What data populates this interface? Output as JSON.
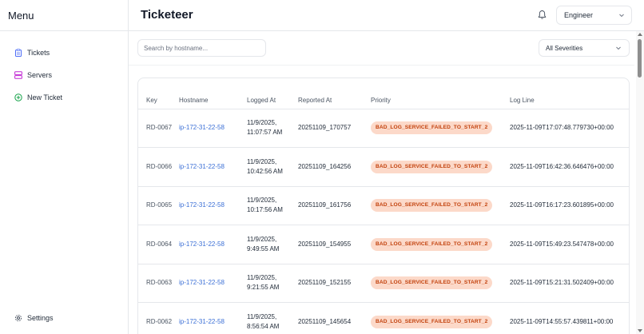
{
  "sidebar": {
    "title": "Menu",
    "items": [
      {
        "label": "Tickets",
        "icon": "clipboard-icon",
        "color": "#4f6ef7"
      },
      {
        "label": "Servers",
        "icon": "server-icon",
        "color": "#c026d3"
      },
      {
        "label": "New Ticket",
        "icon": "plus-circle-icon",
        "color": "#16a34a"
      }
    ],
    "settings": {
      "label": "Settings",
      "icon": "gear-icon"
    }
  },
  "header": {
    "title": "Ticketeer",
    "role": "Engineer"
  },
  "filters": {
    "search_placeholder": "Search by hostname...",
    "severity": "All Severities"
  },
  "table": {
    "columns": [
      "Key",
      "Hostname",
      "Logged At",
      "Reported At",
      "Priority",
      "Log Line"
    ],
    "rows": [
      {
        "key": "RD-0067",
        "hostname": "ip-172-31-22-58",
        "logged_at": "11/9/2025, 11:07:57 AM",
        "reported_at": "20251109_170757",
        "priority": "BAD_LOG_SERVICE_FAILED_TO_START_2",
        "log_line": "2025-11-09T17:07:48.779730+00:00"
      },
      {
        "key": "RD-0066",
        "hostname": "ip-172-31-22-58",
        "logged_at": "11/9/2025, 10:42:56 AM",
        "reported_at": "20251109_164256",
        "priority": "BAD_LOG_SERVICE_FAILED_TO_START_2",
        "log_line": "2025-11-09T16:42:36.646476+00:00"
      },
      {
        "key": "RD-0065",
        "hostname": "ip-172-31-22-58",
        "logged_at": "11/9/2025, 10:17:56 AM",
        "reported_at": "20251109_161756",
        "priority": "BAD_LOG_SERVICE_FAILED_TO_START_2",
        "log_line": "2025-11-09T16:17:23.601895+00:00"
      },
      {
        "key": "RD-0064",
        "hostname": "ip-172-31-22-58",
        "logged_at": "11/9/2025, 9:49:55 AM",
        "reported_at": "20251109_154955",
        "priority": "BAD_LOG_SERVICE_FAILED_TO_START_2",
        "log_line": "2025-11-09T15:49:23.547478+00:00"
      },
      {
        "key": "RD-0063",
        "hostname": "ip-172-31-22-58",
        "logged_at": "11/9/2025, 9:21:55 AM",
        "reported_at": "20251109_152155",
        "priority": "BAD_LOG_SERVICE_FAILED_TO_START_2",
        "log_line": "2025-11-09T15:21:31.502409+00:00"
      },
      {
        "key": "RD-0062",
        "hostname": "ip-172-31-22-58",
        "logged_at": "11/9/2025, 8:56:54 AM",
        "reported_at": "20251109_145654",
        "priority": "BAD_LOG_SERVICE_FAILED_TO_START_2",
        "log_line": "2025-11-09T14:55:57.439811+00:00"
      }
    ]
  },
  "colors": {
    "link": "#3b6fd6",
    "badge_bg": "#fcd9c9",
    "badge_text": "#c2410c"
  }
}
